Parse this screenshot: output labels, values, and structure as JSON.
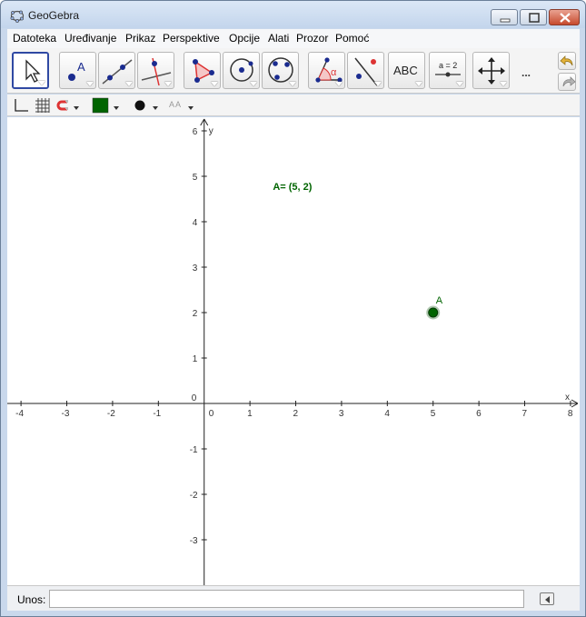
{
  "window": {
    "title": "GeoGebra"
  },
  "menubar": {
    "items": [
      "Datoteka",
      "Uređivanje",
      "Prikaz",
      "Perspektive",
      "Opcije",
      "Alati",
      "Prozor",
      "Pomoć"
    ]
  },
  "toolbar": {
    "tools": [
      {
        "name": "move-tool",
        "icon": "cursor-arrow-icon",
        "active": true
      },
      {
        "name": "point-tool",
        "icon": "point-a-icon",
        "label": "A"
      },
      {
        "name": "line-tool",
        "icon": "line-through-points-icon"
      },
      {
        "name": "perpendicular-tool",
        "icon": "perpendicular-line-icon"
      },
      {
        "name": "polygon-tool",
        "icon": "polygon-icon"
      },
      {
        "name": "circle-center-tool",
        "icon": "circle-center-point-icon"
      },
      {
        "name": "circle-three-points-tool",
        "icon": "circle-three-points-icon"
      },
      {
        "name": "angle-tool",
        "icon": "angle-icon",
        "label": "α"
      },
      {
        "name": "reflect-tool",
        "icon": "reflect-about-line-icon"
      },
      {
        "name": "text-tool",
        "icon": "text-icon",
        "label": "ABC"
      },
      {
        "name": "slider-tool",
        "icon": "slider-icon",
        "label": "a = 2"
      },
      {
        "name": "move-view-tool",
        "icon": "move-graphics-view-icon"
      }
    ],
    "more_label": "...",
    "undo_icon": "undo-icon",
    "redo_icon": "redo-icon"
  },
  "stylebar": {
    "axes_icon": "axes-icon",
    "grid_icon": "grid-icon",
    "snap_icon": "magnet-icon",
    "color": "#006400",
    "point_style_icon": "point-style-icon",
    "label_style_text": "AA"
  },
  "graphics": {
    "axis_x_label": "x",
    "axis_y_label": "y",
    "x_ticks": [
      "-4",
      "-3",
      "-2",
      "-1",
      "0",
      "1",
      "2",
      "3",
      "4",
      "5",
      "6",
      "7",
      "8"
    ],
    "y_ticks": [
      "6",
      "5",
      "4",
      "3",
      "2",
      "1",
      "0",
      "-1",
      "-2",
      "-3"
    ],
    "x_range": [
      -4.3,
      8.2
    ],
    "y_range": [
      -4,
      6.3
    ],
    "point": {
      "name": "A",
      "x": 5,
      "y": 2,
      "color": "#006400"
    },
    "point_text": "A= (5, 2)",
    "point_text_anchor": {
      "x": 1.5,
      "y": 4.7
    }
  },
  "inputbar": {
    "label": "Unos:",
    "value": "",
    "help_icon": "input-help-icon"
  }
}
